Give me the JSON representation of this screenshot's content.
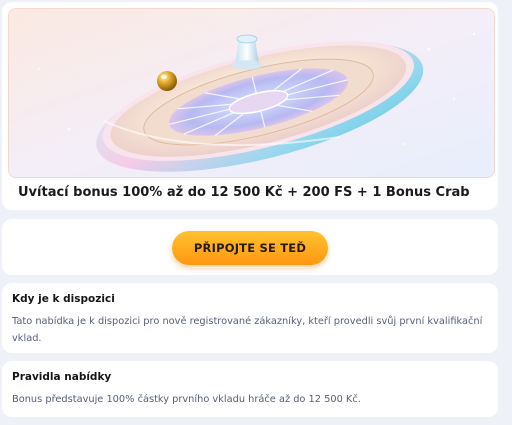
{
  "hero": {
    "image_name": "roulette-wheel-illustration",
    "title": "Uvítací bonus 100% až do 12 500 Kč + 200 FS + 1 Bonus Crab"
  },
  "cta": {
    "join_label": "PŘIPOJTE SE TEĎ",
    "button_color": "#ffab1f"
  },
  "availability": {
    "heading": "Kdy je k dispozici",
    "text": "Tato nabídka je k dispozici pro nově registrované zákazníky, kteří provedli svůj první kvalifikační vklad."
  },
  "rules": {
    "heading": "Pravidla nabídky",
    "text": "Bonus představuje 100% částky prvního vkladu hráče až do 12 500 Kč."
  },
  "colors": {
    "page_bg": "#eef1f8",
    "card_bg": "#ffffff",
    "text_muted": "#55607a"
  }
}
